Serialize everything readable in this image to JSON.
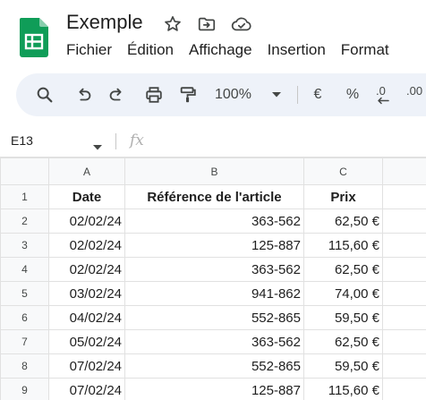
{
  "app": {
    "doc_title": "Exemple",
    "logo_icon": "google-sheets-logo",
    "title_icons": [
      "star-icon",
      "move-to-folder-icon",
      "cloud-saved-icon"
    ]
  },
  "menu": [
    "Fichier",
    "Édition",
    "Affichage",
    "Insertion",
    "Format"
  ],
  "toolbar": {
    "icons": [
      "search-icon",
      "undo-icon",
      "redo-icon",
      "print-icon",
      "paint-format-icon"
    ],
    "zoom": "100%",
    "currency": "€",
    "percent": "%",
    "decrease_decimals": ".0",
    "increase_decimals": ".00"
  },
  "formula_bar": {
    "cell_ref": "E13",
    "fx": "fx",
    "value": ""
  },
  "grid": {
    "columns": [
      "A",
      "B",
      "C",
      ""
    ],
    "rows": [
      {
        "num": "1",
        "cells": [
          "Date",
          "Référence de l'article",
          "Prix",
          ""
        ]
      },
      {
        "num": "2",
        "cells": [
          "02/02/24",
          "363-562",
          "62,50 €",
          ""
        ]
      },
      {
        "num": "3",
        "cells": [
          "02/02/24",
          "125-887",
          "115,60 €",
          ""
        ]
      },
      {
        "num": "4",
        "cells": [
          "02/02/24",
          "363-562",
          "62,50 €",
          ""
        ]
      },
      {
        "num": "5",
        "cells": [
          "03/02/24",
          "941-862",
          "74,00 €",
          ""
        ]
      },
      {
        "num": "6",
        "cells": [
          "04/02/24",
          "552-865",
          "59,50 €",
          ""
        ]
      },
      {
        "num": "7",
        "cells": [
          "05/02/24",
          "363-562",
          "62,50 €",
          ""
        ]
      },
      {
        "num": "8",
        "cells": [
          "07/02/24",
          "552-865",
          "59,50 €",
          ""
        ]
      },
      {
        "num": "9",
        "cells": [
          "07/02/24",
          "125-887",
          "115,60 €",
          ""
        ]
      }
    ]
  },
  "colors": {
    "sheets_green": "#0f9d58",
    "toolbar_bg": "#eef2f9",
    "grid_line": "#e1e1e1",
    "header_bg": "#f8f9fa"
  }
}
